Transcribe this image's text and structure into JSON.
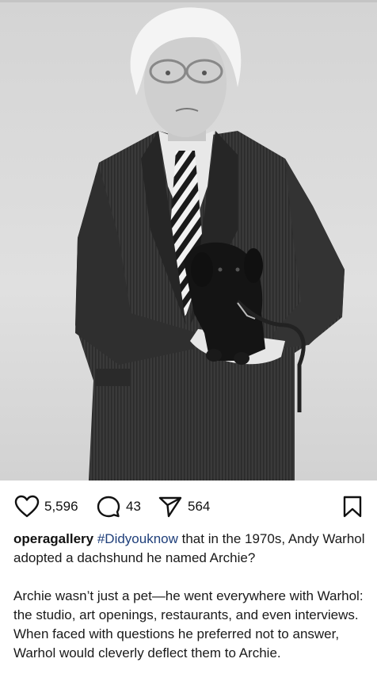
{
  "post": {
    "image_icon": "post-photo",
    "stats": {
      "likes": "5,596",
      "comments": "43",
      "shares": "564"
    },
    "icons": {
      "like": "heart-icon",
      "comment": "comment-icon",
      "share": "send-icon",
      "save": "bookmark-icon"
    },
    "caption": {
      "username": "operagallery",
      "hashtag": "#Didyouknow",
      "text_1": " that in the 1970s, Andy Warhol adopted a dachshund he named Archie?",
      "text_2": "Archie wasn’t just a pet—he went everywhere with Warhol: the studio, art openings, restaurants, and even interviews. When faced with questions he preferred not to answer, Warhol would cleverly deflect them to Archie."
    },
    "colors": {
      "hashtag": "#1f3f7a",
      "text": "#111111",
      "background": "#ffffff"
    }
  }
}
